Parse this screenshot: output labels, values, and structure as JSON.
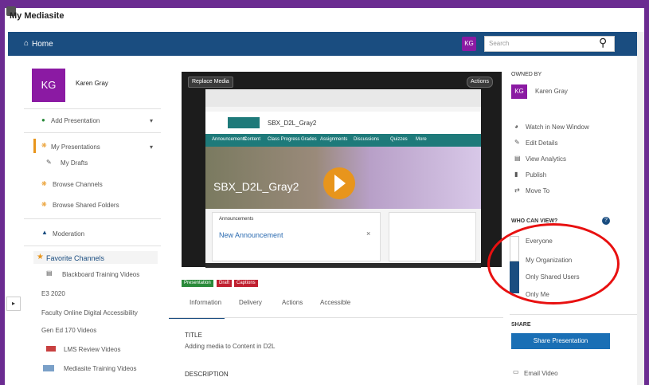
{
  "app": {
    "title": "My Mediasite"
  },
  "nav": {
    "home_label": "Home",
    "avatar_initials": "KG",
    "search_placeholder": "Search"
  },
  "user": {
    "initials": "KG",
    "name": "Karen Gray"
  },
  "sidebar": {
    "add_presentation": "Add Presentation",
    "my_presentations": "My Presentations",
    "my_drafts": "My Drafts",
    "browse_channels": "Browse Channels",
    "browse_shared_folders": "Browse Shared Folders",
    "moderation": "Moderation",
    "favorite_channels_header": "Favorite Channels",
    "favorites": [
      "Blackboard Training Videos",
      "E3 2020",
      "Faculty Online Digital Accessibility",
      "Gen Ed 170 Videos",
      "LMS Review Videos",
      "Mediasite Training Videos"
    ]
  },
  "player": {
    "replace_media": "Replace Media",
    "actions": "Actions",
    "banner_text": "SBX_D2L_Gray2",
    "site_name": "SBX_D2L_Gray2",
    "nav_items": [
      "Announcements",
      "Content",
      "Class Progress",
      "Grades",
      "Assignments",
      "Discussions",
      "Quizzes",
      "More"
    ],
    "announcement_title": "New Announcement",
    "announcement_heading": "Announcements"
  },
  "tags": [
    "Presentation",
    "Draft",
    "Captions"
  ],
  "tabs": [
    "Information",
    "Delivery",
    "Actions",
    "Accessible"
  ],
  "info": {
    "title_label": "TITLE",
    "title_value": "Adding media to Content in D2L",
    "description_label": "DESCRIPTION"
  },
  "owner": {
    "header": "OWNED BY",
    "initials": "KG",
    "name": "Karen Gray"
  },
  "actions": [
    "Watch in New Window",
    "Edit Details",
    "View Analytics",
    "Publish",
    "Move To"
  ],
  "visibility": {
    "header": "WHO CAN VIEW?",
    "options": [
      "Everyone",
      "My Organization",
      "Only Shared Users",
      "Only Me"
    ],
    "selected": "Only Shared Users"
  },
  "share": {
    "header": "SHARE",
    "button": "Share Presentation",
    "email": "Email Video"
  },
  "colors": {
    "brand": "#6b2c91",
    "navbar": "#1a4d80",
    "avatar": "#8b1aa3",
    "annotation": "#e81010"
  }
}
